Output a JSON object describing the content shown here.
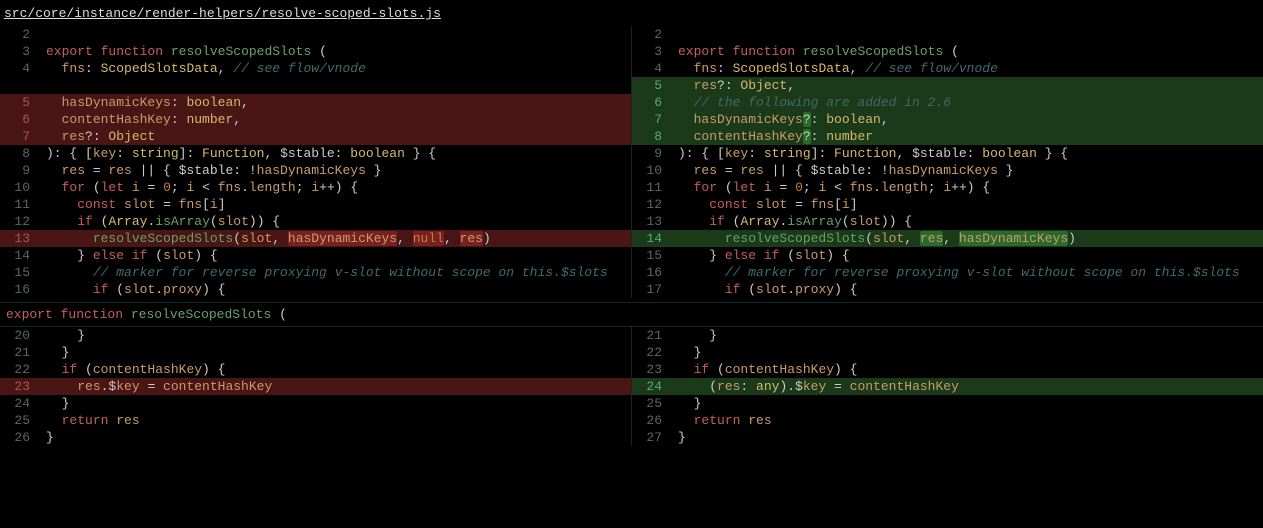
{
  "file_path": "src/core/instance/render-helpers/resolve-scoped-slots.js",
  "hunk2_header": "export function resolveScopedSlots (",
  "left": {
    "hunk1": [
      {
        "n": 2,
        "t": "",
        "kind": "ctx"
      },
      {
        "n": 3,
        "t": "export function resolveScopedSlots (",
        "kind": "ctx"
      },
      {
        "n": 4,
        "t": "  fns: ScopedSlotsData, // see flow/vnode",
        "kind": "ctx"
      },
      {
        "n": "",
        "t": "",
        "kind": "ctx"
      },
      {
        "n": 5,
        "t": "  hasDynamicKeys: boolean,",
        "kind": "del"
      },
      {
        "n": 6,
        "t": "  contentHashKey: number,",
        "kind": "del",
        "inl": [
          [
            25,
            26
          ]
        ]
      },
      {
        "n": 7,
        "t": "  res?: Object",
        "kind": "del"
      },
      {
        "n": 8,
        "t": "): { [key: string]: Function, $stable: boolean } {",
        "kind": "ctx"
      },
      {
        "n": 9,
        "t": "  res = res || { $stable: !hasDynamicKeys }",
        "kind": "ctx"
      },
      {
        "n": 10,
        "t": "  for (let i = 0; i < fns.length; i++) {",
        "kind": "ctx"
      },
      {
        "n": 11,
        "t": "    const slot = fns[i]",
        "kind": "ctx"
      },
      {
        "n": 12,
        "t": "    if (Array.isArray(slot)) {",
        "kind": "ctx"
      },
      {
        "n": 13,
        "t": "      resolveScopedSlots(slot, hasDynamicKeys, null, res)",
        "kind": "del",
        "inl": [
          [
            31,
            45
          ],
          [
            47,
            51
          ],
          [
            53,
            56
          ]
        ]
      },
      {
        "n": 14,
        "t": "    } else if (slot) {",
        "kind": "ctx"
      },
      {
        "n": 15,
        "t": "      // marker for reverse proxying v-slot without scope on this.$slots",
        "kind": "ctx"
      },
      {
        "n": 16,
        "t": "      if (slot.proxy) {",
        "kind": "ctx"
      }
    ],
    "hunk2": [
      {
        "n": 20,
        "t": "    }",
        "kind": "ctx"
      },
      {
        "n": 21,
        "t": "  }",
        "kind": "ctx"
      },
      {
        "n": 22,
        "t": "  if (contentHashKey) {",
        "kind": "ctx"
      },
      {
        "n": 23,
        "t": "    res.$key = contentHashKey",
        "kind": "del"
      },
      {
        "n": 24,
        "t": "  }",
        "kind": "ctx"
      },
      {
        "n": 25,
        "t": "  return res",
        "kind": "ctx"
      },
      {
        "n": 26,
        "t": "}",
        "kind": "ctx"
      }
    ]
  },
  "right": {
    "hunk1": [
      {
        "n": 2,
        "t": "",
        "kind": "ctx"
      },
      {
        "n": 3,
        "t": "export function resolveScopedSlots (",
        "kind": "ctx"
      },
      {
        "n": 4,
        "t": "  fns: ScopedSlotsData, // see flow/vnode",
        "kind": "ctx"
      },
      {
        "n": 5,
        "t": "  res?: Object,",
        "kind": "add"
      },
      {
        "n": 6,
        "t": "  // the following are added in 2.6",
        "kind": "add"
      },
      {
        "n": 7,
        "t": "  hasDynamicKeys?: boolean,",
        "kind": "add",
        "inl": [
          [
            16,
            17
          ]
        ]
      },
      {
        "n": 8,
        "t": "  contentHashKey?: number",
        "kind": "add",
        "inl": [
          [
            16,
            17
          ]
        ]
      },
      {
        "n": 9,
        "t": "): { [key: string]: Function, $stable: boolean } {",
        "kind": "ctx"
      },
      {
        "n": 10,
        "t": "  res = res || { $stable: !hasDynamicKeys }",
        "kind": "ctx"
      },
      {
        "n": 11,
        "t": "  for (let i = 0; i < fns.length; i++) {",
        "kind": "ctx"
      },
      {
        "n": 12,
        "t": "    const slot = fns[i]",
        "kind": "ctx"
      },
      {
        "n": 13,
        "t": "    if (Array.isArray(slot)) {",
        "kind": "ctx"
      },
      {
        "n": 14,
        "t": "      resolveScopedSlots(slot, res, hasDynamicKeys)",
        "kind": "add",
        "inl": [
          [
            31,
            34
          ],
          [
            36,
            50
          ]
        ]
      },
      {
        "n": 15,
        "t": "    } else if (slot) {",
        "kind": "ctx"
      },
      {
        "n": 16,
        "t": "      // marker for reverse proxying v-slot without scope on this.$slots",
        "kind": "ctx"
      },
      {
        "n": 17,
        "t": "      if (slot.proxy) {",
        "kind": "ctx"
      }
    ],
    "hunk2": [
      {
        "n": 21,
        "t": "    }",
        "kind": "ctx"
      },
      {
        "n": 22,
        "t": "  }",
        "kind": "ctx"
      },
      {
        "n": 23,
        "t": "  if (contentHashKey) {",
        "kind": "ctx"
      },
      {
        "n": 24,
        "t": "    (res: any).$key = contentHashKey",
        "kind": "add"
      },
      {
        "n": 25,
        "t": "  }",
        "kind": "ctx"
      },
      {
        "n": 26,
        "t": "  return res",
        "kind": "ctx"
      },
      {
        "n": 27,
        "t": "}",
        "kind": "ctx"
      }
    ]
  }
}
